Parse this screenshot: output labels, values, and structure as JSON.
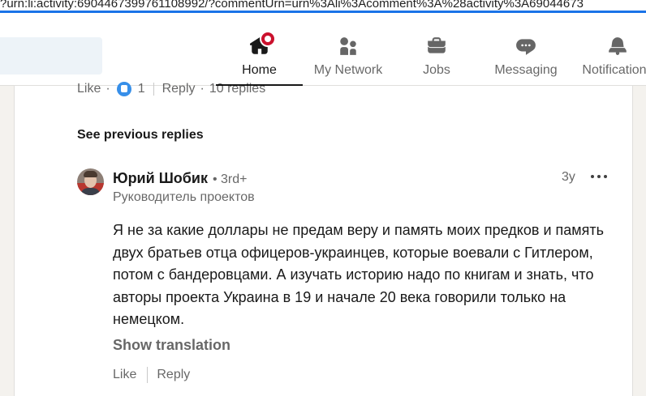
{
  "browser": {
    "url": "?urn:li:activity:6904467399761108992/?commentUrn=urn%3Ali%3Acomment%3A%28activity%3A69044673"
  },
  "nav": {
    "items": [
      {
        "label": "Home",
        "icon": "home-icon",
        "active": true,
        "badge": true
      },
      {
        "label": "My Network",
        "icon": "people-icon",
        "active": false
      },
      {
        "label": "Jobs",
        "icon": "briefcase-icon",
        "active": false
      },
      {
        "label": "Messaging",
        "icon": "chat-bubble-icon",
        "active": false
      },
      {
        "label": "Notifications",
        "icon": "bell-icon",
        "active": false
      }
    ]
  },
  "previous_comment": {
    "like_label": "Like",
    "separator": "·",
    "reaction_count": "1",
    "reply_label": "Reply",
    "replies_count": "10 replies"
  },
  "see_previous_replies": "See previous replies",
  "reply": {
    "author_name": "Юрий Шобик",
    "degree": "• 3rd+",
    "headline": "Руководитель проектов",
    "timestamp": "3y",
    "text": "Я не за какие доллары не предам веру и память моих предков и память двух братьев отца офицеров-украинцев, которые воевали с Гитлером, потом с бандеровцами. А изучать историю надо по книгам и знать, что авторы проекта Украина в 19 и начале 20 века говорили только на немецком.",
    "show_translation": "Show translation",
    "like_label": "Like",
    "reply_label": "Reply"
  },
  "colors": {
    "notification_badge": "#cb112d",
    "reaction_blue": "#378fe9",
    "url_underline": "#1a73e8"
  }
}
